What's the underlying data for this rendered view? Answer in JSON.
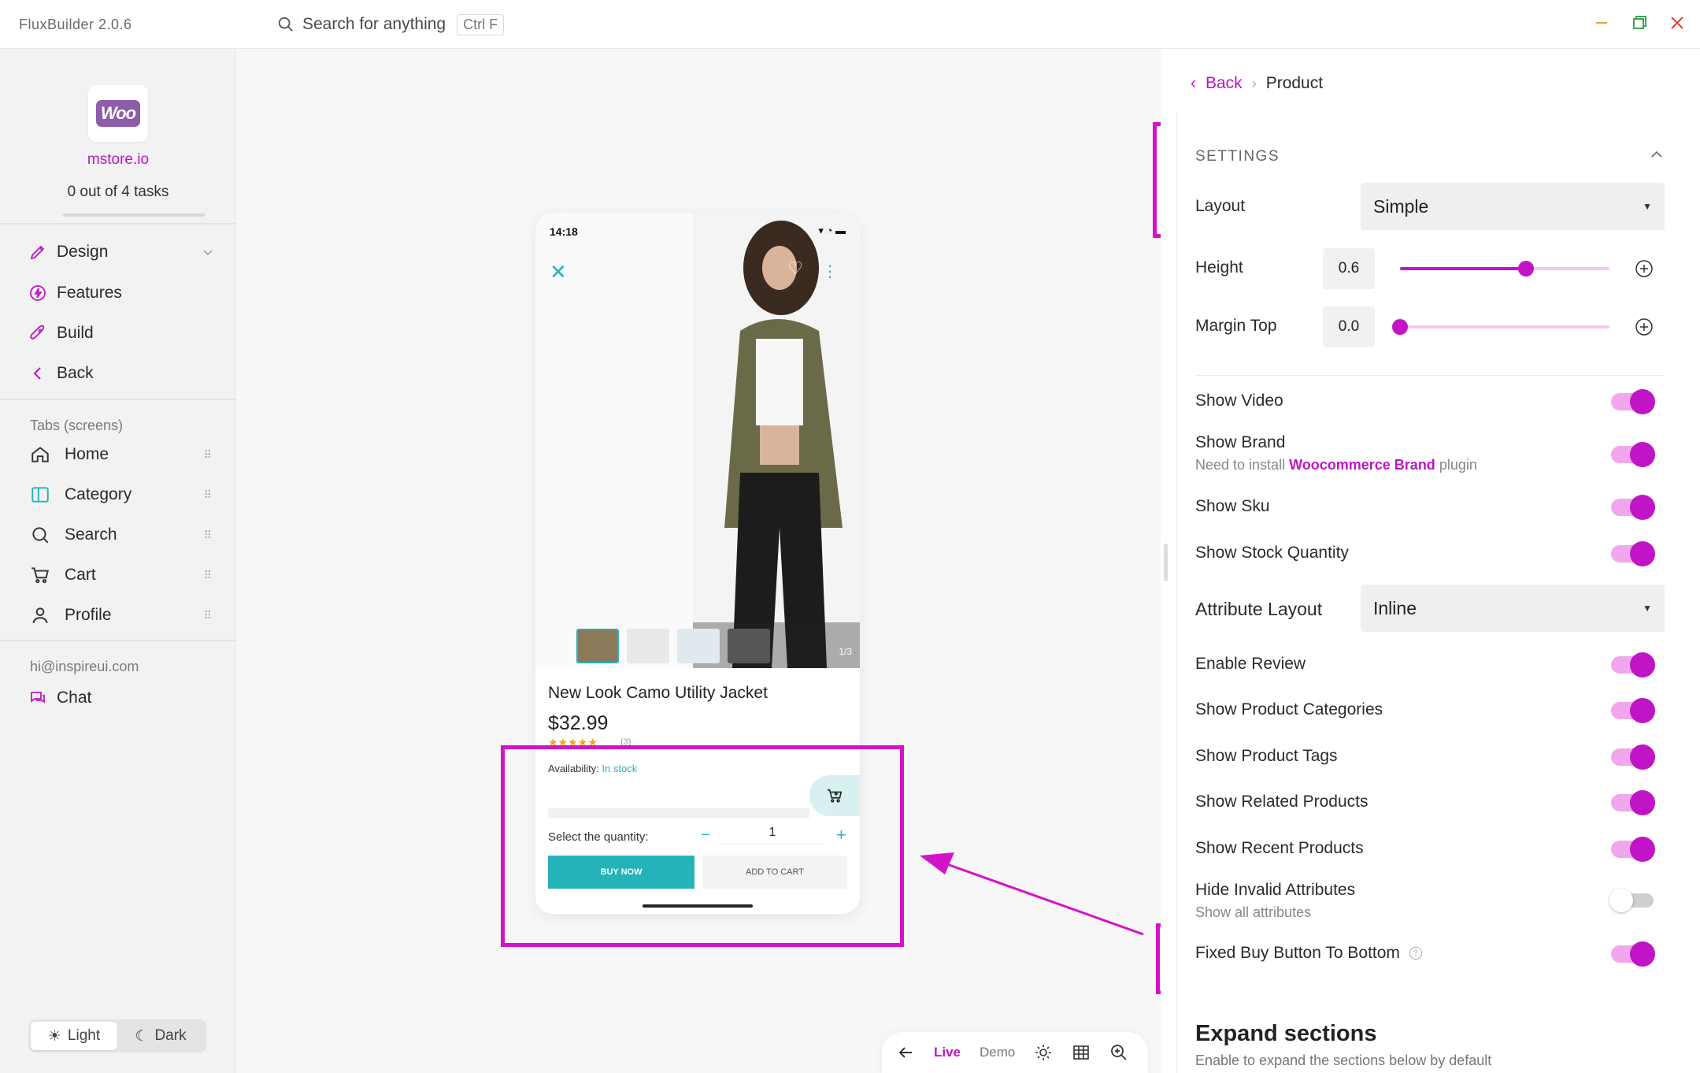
{
  "app": {
    "title": "FluxBuilder 2.0.6"
  },
  "search": {
    "placeholder": "Search for anything",
    "shortcut": "Ctrl F"
  },
  "window_controls": [
    "minimize-icon",
    "maximize-icon",
    "close-icon"
  ],
  "colors": {
    "accent": "#c014c6",
    "teal": "#24b3b8",
    "highlight": "#d512c9"
  },
  "sidebar": {
    "logo_text": "Woo",
    "store_name": "mstore.io",
    "tasks": "0 out of 4 tasks",
    "nav": [
      {
        "label": "Design",
        "icon": "brush-icon"
      },
      {
        "label": "Features",
        "icon": "bolt-icon"
      },
      {
        "label": "Build",
        "icon": "rocket-icon"
      },
      {
        "label": "Back",
        "icon": "chevron-left-icon"
      }
    ],
    "tabs_label": "Tabs (screens)",
    "tabs": [
      {
        "label": "Home",
        "icon": "home-icon"
      },
      {
        "label": "Category",
        "icon": "category-icon"
      },
      {
        "label": "Search",
        "icon": "search-icon"
      },
      {
        "label": "Cart",
        "icon": "cart-icon"
      },
      {
        "label": "Profile",
        "icon": "profile-icon"
      }
    ],
    "email": "hi@inspireui.com",
    "chat": "Chat",
    "theme": {
      "light": "Light",
      "dark": "Dark",
      "selected": "Light"
    }
  },
  "preview": {
    "time": "14:18",
    "page_indicator": "1/3",
    "product_title": "New Look Camo Utility Jacket",
    "price": "$32.99",
    "stars": "★★★★★",
    "reviews": "(3)",
    "availability_label": "Availability:",
    "availability_value": "In stock",
    "quantity_label": "Select the quantity:",
    "quantity": "1",
    "buy_now": "BUY NOW",
    "add_to_cart": "ADD TO CART"
  },
  "toolbar": {
    "live": "Live",
    "demo": "Demo"
  },
  "panel": {
    "breadcrumb_back": "Back",
    "breadcrumb_current": "Product",
    "settings_header": "SETTINGS",
    "layout_label": "Layout",
    "layout_value": "Simple",
    "height_label": "Height",
    "height_value": "0.6",
    "height_fraction": 0.6,
    "margin_top_label": "Margin Top",
    "margin_top_value": "0.0",
    "margin_top_fraction": 0.0,
    "toggles_a": [
      {
        "label": "Show Video",
        "on": true
      },
      {
        "label": "Show Brand",
        "on": true
      },
      {
        "label": "Show Sku",
        "on": true
      },
      {
        "label": "Show Stock Quantity",
        "on": true
      }
    ],
    "brand_note_prefix": "Need to install",
    "brand_note_link": "Woocommerce Brand",
    "brand_note_suffix": "plugin",
    "attribute_layout_label": "Attribute Layout",
    "attribute_layout_value": "Inline",
    "toggles_b": [
      {
        "label": "Enable Review",
        "on": true
      },
      {
        "label": "Show Product Categories",
        "on": true
      },
      {
        "label": "Show Product Tags",
        "on": true
      },
      {
        "label": "Show Related Products",
        "on": true
      },
      {
        "label": "Show Recent Products",
        "on": true
      },
      {
        "label": "Hide Invalid Attributes",
        "on": false
      },
      {
        "label": "Fixed Buy Button To Bottom",
        "on": true
      }
    ],
    "hide_invalid_sub": "Show all attributes",
    "expand_title": "Expand sections",
    "expand_sub": "Enable to expand the sections below by default"
  }
}
